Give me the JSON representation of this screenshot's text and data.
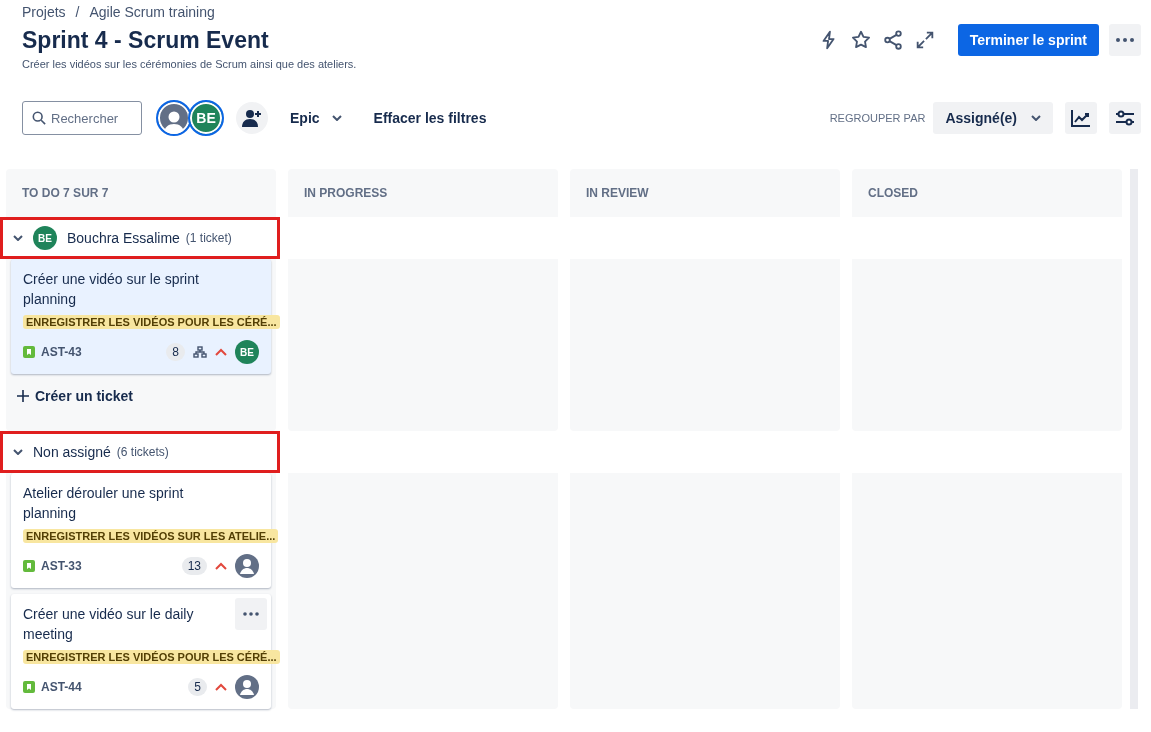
{
  "breadcrumbs": [
    "Projets",
    "Agile Scrum training"
  ],
  "breadcrumb_separator": "/",
  "title": "Sprint 4 - Scrum Event",
  "subtitle": "Créer les vidéos sur les cérémonies de Scrum ainsi que des ateliers.",
  "primary_button": "Terminer le sprint",
  "search": {
    "placeholder": "Rechercher"
  },
  "avatars": [
    {
      "kind": "person",
      "color": "#626f86"
    },
    {
      "kind": "initials",
      "initials": "BE",
      "color": "#1f845a"
    }
  ],
  "epic_filter": "Epic",
  "clear_filters": "Effacer les filtres",
  "group_by_label": "REGROUPER PAR",
  "group_by_value": "Assigné(e)",
  "columns": [
    "TO DO 7 SUR 7",
    "IN PROGRESS",
    "IN REVIEW",
    "CLOSED"
  ],
  "swimlanes": [
    {
      "name": "Bouchra Essalime",
      "count": "(1 ticket)",
      "avatar": "BE",
      "highlighted": true,
      "expanded": true,
      "create_label": "Créer un ticket",
      "cards": [
        {
          "title": "Créer une vidéo sur le sprint planning",
          "epic": "ENREGISTRER LES VIDÉOS POUR LES CÉRÉ...",
          "key": "AST-43",
          "points": "8",
          "subtasks": true,
          "assignee": "BE",
          "selected": true,
          "menu": false
        }
      ]
    },
    {
      "name": "Non assigné",
      "count": "(6 tickets)",
      "highlighted": true,
      "expanded": true,
      "cards": [
        {
          "title": "Atelier dérouler une sprint planning",
          "epic": "ENREGISTRER LES VIDÉOS SUR LES ATELIE...",
          "key": "AST-33",
          "points": "13",
          "subtasks": false,
          "selected": false,
          "menu": false
        },
        {
          "title": "Créer une vidéo sur le daily meeting",
          "epic": "ENREGISTRER LES VIDÉOS POUR LES CÉRÉ...",
          "key": "AST-44",
          "points": "5",
          "subtasks": false,
          "selected": false,
          "menu": true
        }
      ]
    }
  ]
}
